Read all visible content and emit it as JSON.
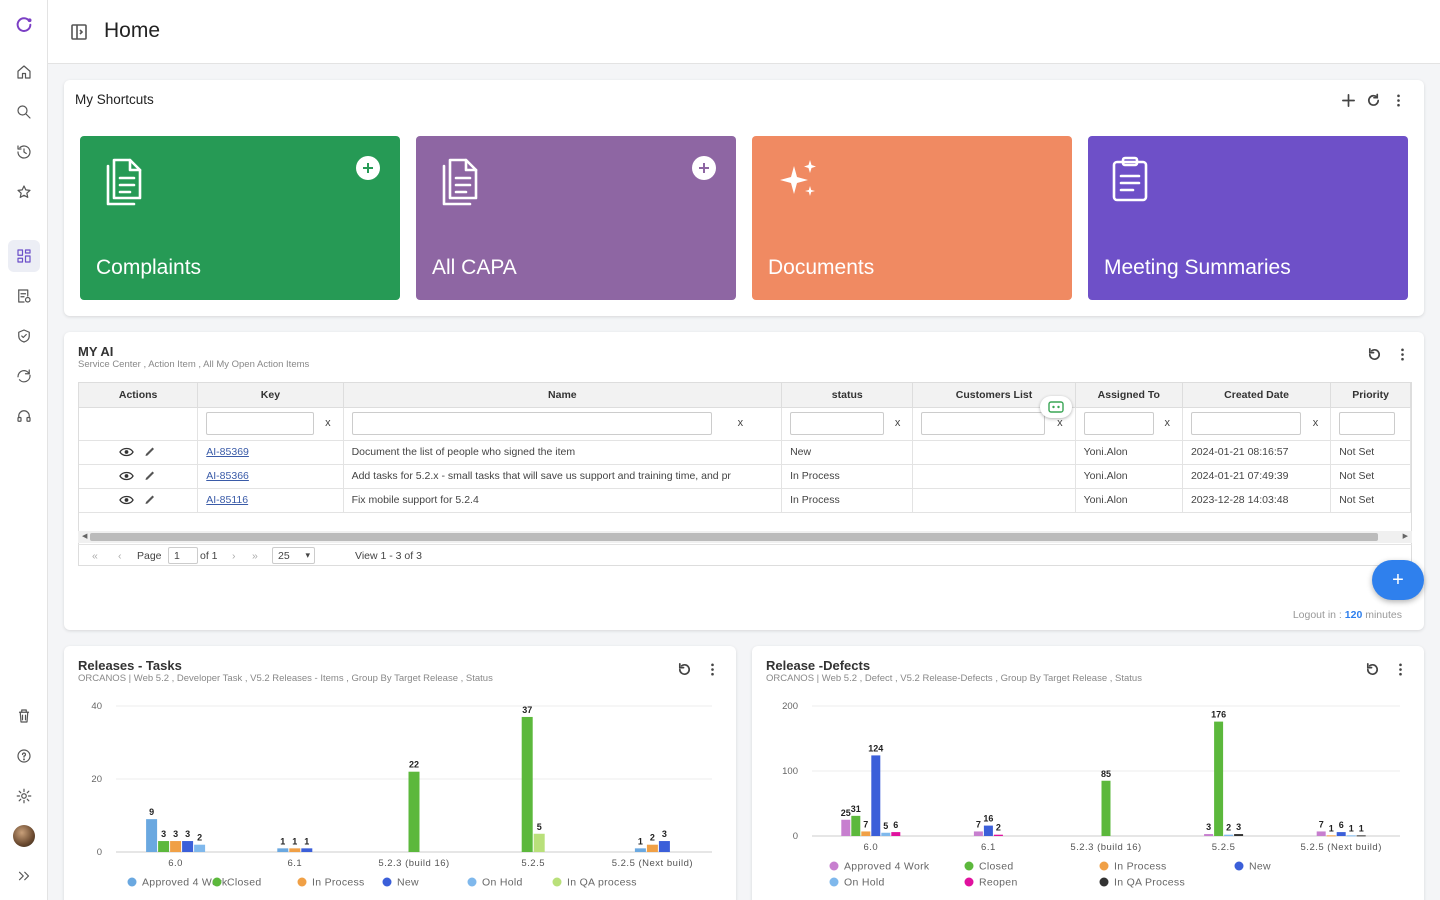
{
  "header": {
    "title": "Home"
  },
  "sidebar": {
    "items": [
      {
        "icon": "logo-icon"
      },
      {
        "icon": "home-icon"
      },
      {
        "icon": "search-icon"
      },
      {
        "icon": "history-icon"
      },
      {
        "icon": "star-icon"
      },
      {
        "icon": "dashboard-icon"
      },
      {
        "icon": "task-list-icon"
      },
      {
        "icon": "shield-icon"
      },
      {
        "icon": "refresh-chat-icon"
      },
      {
        "icon": "headset-icon"
      },
      {
        "icon": "trash-icon"
      },
      {
        "icon": "help-icon"
      },
      {
        "icon": "settings-icon"
      },
      {
        "icon": "avatar"
      },
      {
        "icon": "expand-icon"
      }
    ]
  },
  "shortcuts": {
    "title": "My Shortcuts",
    "tiles": [
      {
        "label": "Complaints",
        "color": "#269a55",
        "icon": "document-icon"
      },
      {
        "label": "All CAPA",
        "color": "#8e66a3",
        "icon": "document-icon"
      },
      {
        "label": "Documents",
        "color": "#f08a62",
        "icon": "sparkles-icon"
      },
      {
        "label": "Meeting Summaries",
        "color": "#6e50c8",
        "icon": "clipboard-icon"
      }
    ]
  },
  "myai": {
    "title": "MY AI",
    "subtitle": "Service Center , Action Item , All My Open Action Items",
    "columns": [
      "Actions",
      "Key",
      "Name",
      "status",
      "Customers List",
      "Assigned To",
      "Created Date",
      "Priority"
    ],
    "filter_clear": "x",
    "rows": [
      {
        "key": "AI-85369",
        "name": "Document the list of people who signed the item",
        "status": "New",
        "customers": "",
        "assigned": "Yoni.Alon",
        "created": "2024-01-21 08:16:57",
        "priority": "Not Set"
      },
      {
        "key": "AI-85366",
        "name": "Add tasks for 5.2.x - small tasks that will save us support and training time, and pr",
        "status": "In Process",
        "customers": "",
        "assigned": "Yoni.Alon",
        "created": "2024-01-21 07:49:39",
        "priority": "Not Set"
      },
      {
        "key": "AI-85116",
        "name": "Fix mobile support for 5.2.4",
        "status": "In Process",
        "customers": "",
        "assigned": "Yoni.Alon",
        "created": "2023-12-28 14:03:48",
        "priority": "Not Set"
      }
    ],
    "pager": {
      "page_label": "Page",
      "page": "1",
      "of": "of 1",
      "page_size": "25",
      "view": "View 1 - 3 of 3"
    },
    "fab": "+",
    "logout": {
      "prefix": "Logout in : ",
      "value": "120",
      "suffix": " minutes"
    }
  },
  "charts": {
    "tasks_title": "Releases - Tasks",
    "tasks_sub": "ORCANOS | Web 5.2 , Developer Task , V5.2 Releases - Items , Group By Target Release , Status",
    "defects_title": "Release -Defects",
    "defects_sub": "ORCANOS | Web 5.2 , Defect , V5.2 Release-Defects , Group By Target Release , Status"
  },
  "chart_data": [
    {
      "type": "bar",
      "title": "Releases - Tasks",
      "categories": [
        "6.0",
        "6.1",
        "5.2.3 (build 16)",
        "5.2.5",
        "5.2.5 (Next build)"
      ],
      "ylim": [
        0,
        40
      ],
      "yticks": [
        0,
        20,
        40
      ],
      "legend_position": "bottom",
      "series": [
        {
          "name": "Approved 4 Work",
          "color": "#6aa8e0",
          "values": [
            9,
            1,
            null,
            null,
            1
          ]
        },
        {
          "name": "Closed",
          "color": "#5cb83c",
          "values": [
            3,
            null,
            22,
            37,
            null
          ]
        },
        {
          "name": "In Process",
          "color": "#f0a046",
          "values": [
            3,
            1,
            null,
            null,
            2
          ]
        },
        {
          "name": "New",
          "color": "#3b5fd9",
          "values": [
            3,
            1,
            null,
            null,
            3
          ]
        },
        {
          "name": "On Hold",
          "color": "#7fb8ec",
          "values": [
            2,
            null,
            null,
            null,
            null
          ]
        },
        {
          "name": "In QA process",
          "color": "#b9e07a",
          "values": [
            null,
            null,
            null,
            5,
            null
          ]
        }
      ]
    },
    {
      "type": "bar",
      "title": "Release -Defects",
      "categories": [
        "6.0",
        "6.1",
        "5.2.3 (build 16)",
        "5.2.5",
        "5.2.5 (Next build)"
      ],
      "ylim": [
        0,
        200
      ],
      "yticks": [
        0,
        100,
        200
      ],
      "legend_position": "bottom",
      "series": [
        {
          "name": "Approved 4 Work",
          "color": "#c77fcf",
          "values": [
            25,
            7,
            null,
            3,
            7
          ]
        },
        {
          "name": "Closed",
          "color": "#5cb83c",
          "values": [
            31,
            null,
            85,
            176,
            null
          ]
        },
        {
          "name": "In Process",
          "color": "#f0a046",
          "values": [
            7,
            null,
            null,
            null,
            1
          ]
        },
        {
          "name": "New",
          "color": "#3b5fd9",
          "values": [
            124,
            16,
            null,
            null,
            6
          ]
        },
        {
          "name": "On Hold",
          "color": "#7fb8ec",
          "values": [
            5,
            null,
            null,
            2,
            1
          ]
        },
        {
          "name": "Reopen",
          "color": "#e0119e",
          "values": [
            6,
            2,
            null,
            null,
            null
          ]
        },
        {
          "name": "In QA Process",
          "color": "#333333",
          "values": [
            null,
            null,
            null,
            3,
            1
          ]
        }
      ]
    }
  ]
}
